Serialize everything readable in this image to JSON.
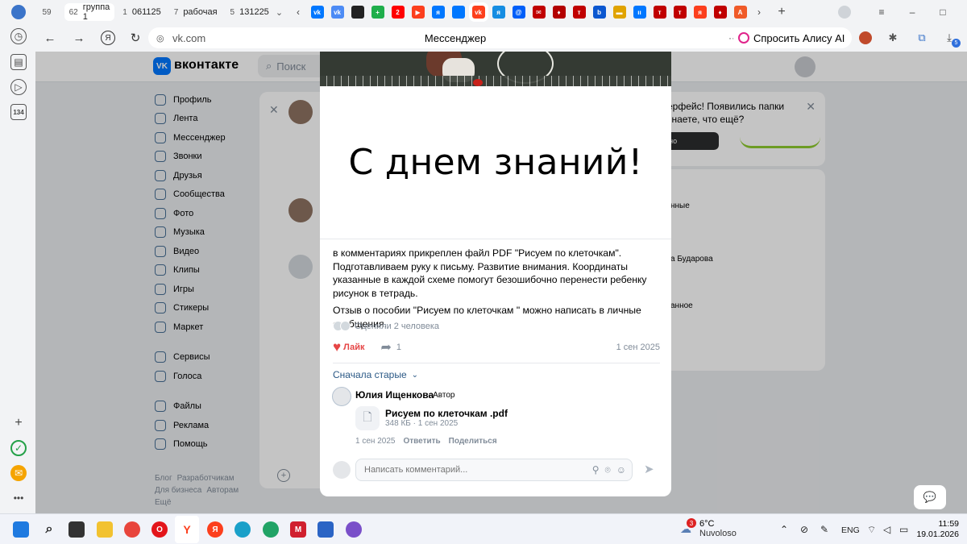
{
  "browser": {
    "tab_groups": [
      {
        "count": "59",
        "label": ""
      },
      {
        "count": "62",
        "label": "группа 1"
      },
      {
        "count": "1",
        "label": "061125"
      },
      {
        "count": "7",
        "label": "рабочая"
      },
      {
        "count": "5",
        "label": "131225"
      }
    ],
    "left_rail_badge": "134",
    "address_host": "vk.com",
    "page_title": "Мессенджер",
    "alice_label": "Спросить Алису AI",
    "download_badge": "5",
    "favicon_colors": [
      "#0077ff",
      "#4c8bf5",
      "#222222",
      "#1fae4b",
      "#ff0000",
      "#fc3f1d",
      "#0077ff",
      "#0077ff",
      "#fc3f1d",
      "#168de2",
      "#005ff9",
      "#c00000",
      "#b30000",
      "#c00000",
      "#0b57d0",
      "#e0a300",
      "#0077ff",
      "#c00000",
      "#c00000",
      "#fc3f1d",
      "#c00000",
      "#f05a28"
    ],
    "favicon_labels": [
      "vk",
      "vk",
      "",
      "+",
      "2",
      "▶",
      "я",
      "",
      "vk",
      "я",
      "@",
      "✉",
      "♦",
      "т",
      "b",
      "▬",
      "ıı",
      "т",
      "т",
      "я",
      "♦",
      "А"
    ]
  },
  "vk": {
    "logo_text": "вконтакте",
    "search_placeholder": "Поиск",
    "menu": {
      "profile": "Профиль",
      "feed": "Лента",
      "messenger": "Мессенджер",
      "calls": "Звонки",
      "friends": "Друзья",
      "communities": "Сообщества",
      "photos": "Фото",
      "music": "Музыка",
      "video": "Видео",
      "clips": "Клипы",
      "games": "Игры",
      "stickers": "Стикеры",
      "market": "Маркет",
      "services": "Сервисы",
      "votes": "Голоса",
      "files": "Файлы",
      "ads": "Реклама",
      "help": "Помощь"
    },
    "footer": {
      "blog": "Блог",
      "developers": "Разработчикам",
      "business": "Для бизнеса",
      "authors": "Авторам",
      "more": "Ещё"
    },
    "banner_line1": "ерфейс! Появились папки",
    "banner_line2": "знаете, что ещё?",
    "banner_button": "тно",
    "right_list": [
      "нные",
      "а Бударова",
      "анное"
    ]
  },
  "post": {
    "greeting": "С днем знаний!",
    "text_p1": "в комментариях прикреплен файл PDF \"Рисуем по клеточкам\". Подготавливаем руку к письму. Развитие внимания. Координаты указанные в каждой схеме помогут безошибочно перенести ребенку рисунок в тетрадь.",
    "text_p2": "Отзыв о пособии \"Рисуем по клеточкам \" можно написать в личные сообщения.",
    "ratings_text": "Оценили 2 человека",
    "like_label": "Лайк",
    "share_count": "1",
    "date": "1 сен 2025",
    "sort_label": "Сначала старые"
  },
  "comment": {
    "author": "Юлия Ищенкова",
    "badge": "· Автор",
    "file_name": "Рисуем по клеточкам .pdf",
    "file_meta": "348 КБ · 1 сен 2025",
    "date": "1 сен 2025",
    "reply": "Ответить",
    "share": "Поделиться",
    "composer_placeholder": "Написать комментарий..."
  },
  "taskbar": {
    "weather_badge": "3",
    "temperature": "6°C",
    "condition": "Nuvoloso",
    "language": "ENG",
    "time": "11:59",
    "date": "19.01.2026"
  }
}
